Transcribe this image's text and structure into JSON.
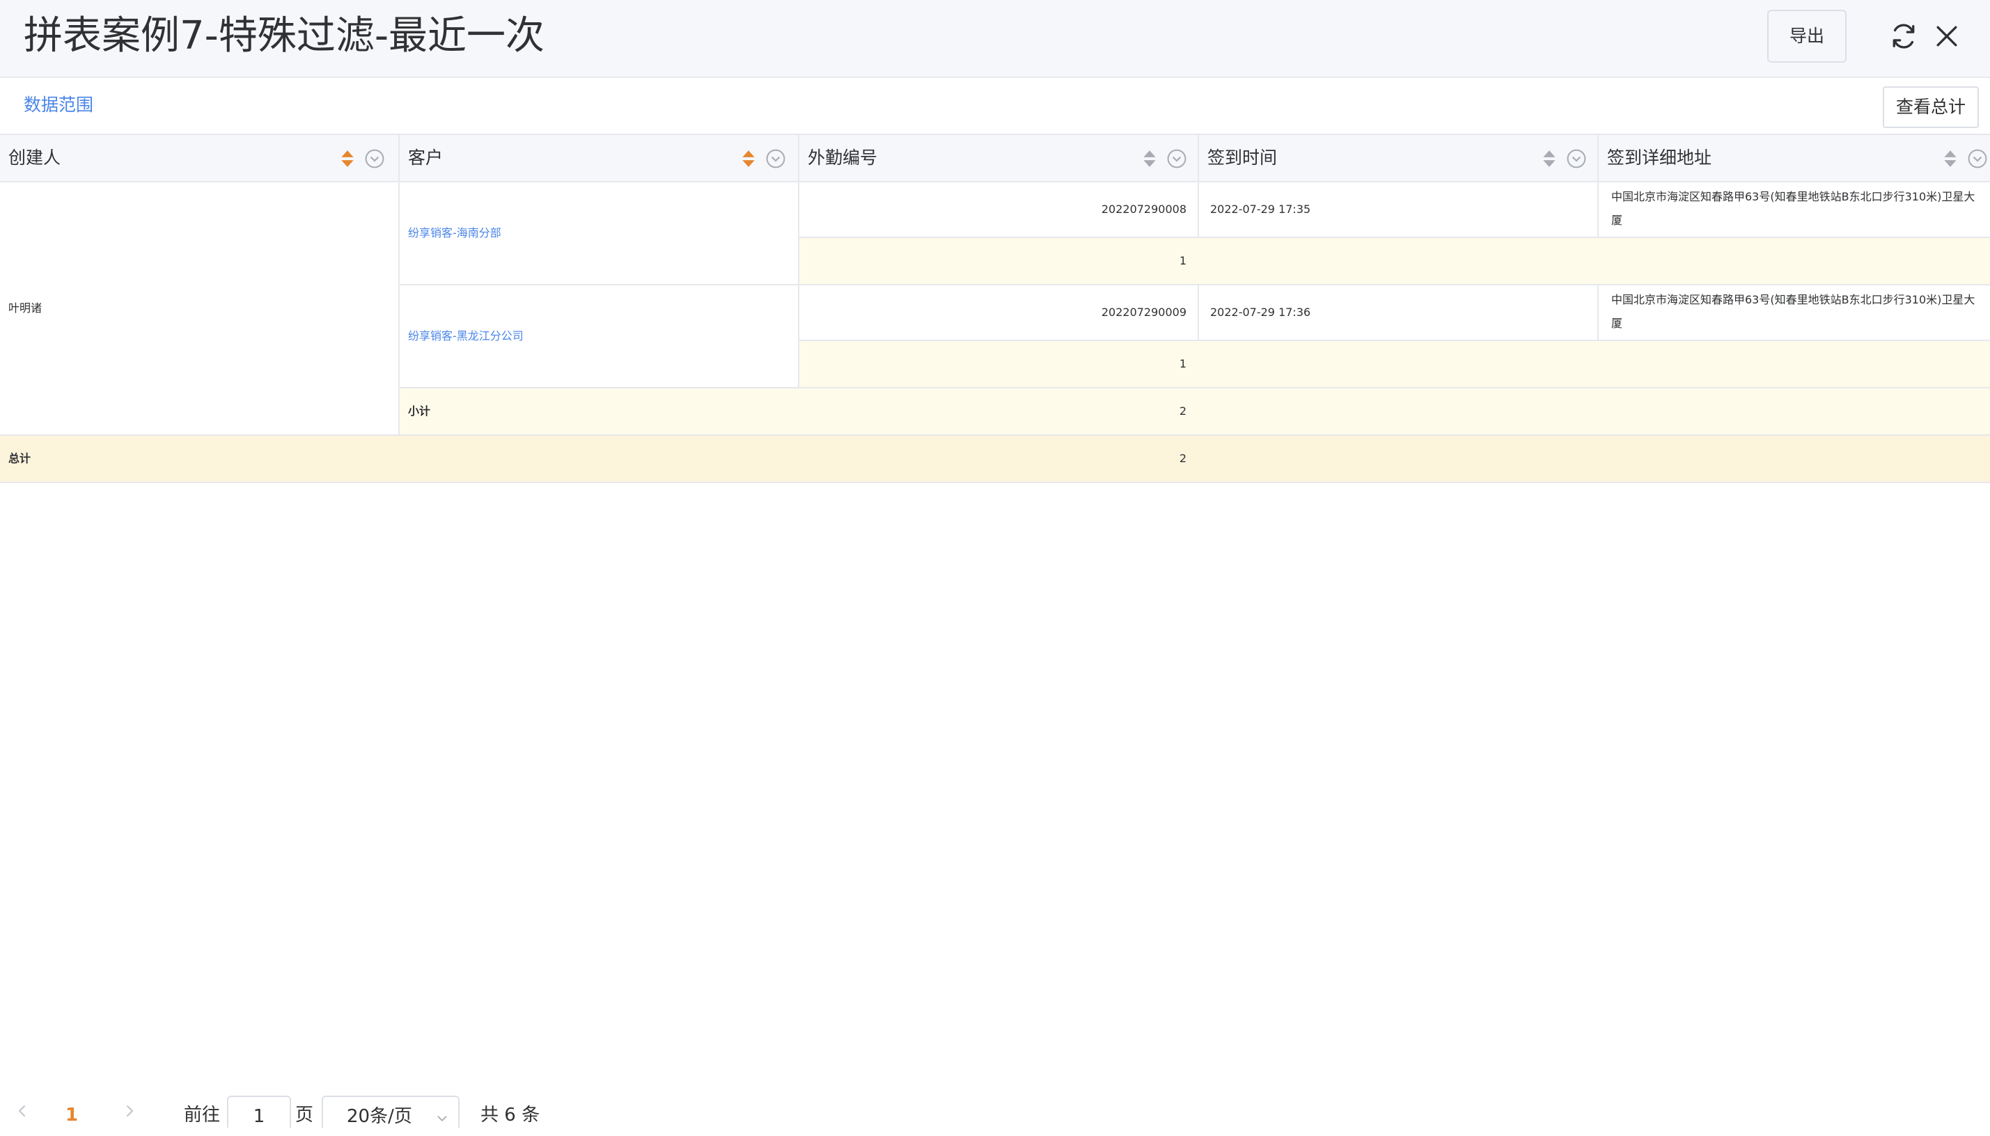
{
  "header": {
    "title": "拼表案例7-特殊过滤-最近一次",
    "export_label": "导出"
  },
  "toolbar": {
    "data_range_label": "数据范围",
    "view_total_label": "查看总计"
  },
  "table": {
    "columns": [
      "创建人",
      "客户",
      "外勤编号",
      "签到时间",
      "签到详细地址"
    ],
    "creator": "叶明诸",
    "groups": [
      {
        "customer": "纷享销客-海南分部",
        "row": {
          "id": "202207290008",
          "time": "2022-07-29 17:35",
          "address": "中国北京市海淀区知春路甲63号(知春里地铁站B东北口步行310米)卫星大厦"
        },
        "count": "1"
      },
      {
        "customer": "纷享销客-黑龙江分公司",
        "row": {
          "id": "202207290009",
          "time": "2022-07-29 17:36",
          "address": "中国北京市海淀区知春路甲63号(知春里地铁站B东北口步行310米)卫星大厦"
        },
        "count": "1"
      }
    ],
    "subtotal_label": "小计",
    "subtotal_value": "2",
    "total_label": "总计",
    "total_value": "2"
  },
  "pagination": {
    "current_page": "1",
    "goto_prefix": "前往",
    "goto_value": "1",
    "goto_suffix": "页",
    "page_size": "20条/页",
    "total_text": "共 6 条"
  },
  "colors": {
    "accent": "#4a86e8",
    "sort_active": "#e6862f",
    "summary_row_bg": "#fffbeb",
    "total_row_bg": "#fdf4dc"
  }
}
